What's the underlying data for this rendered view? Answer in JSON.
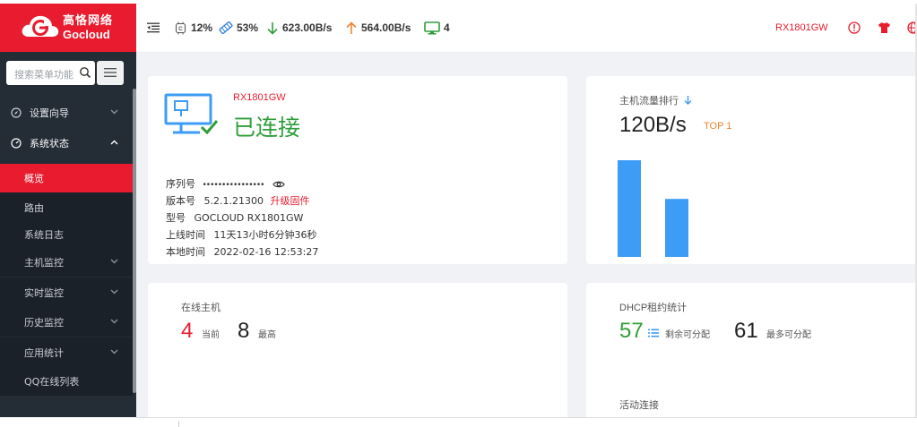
{
  "brand": {
    "name_cn": "高恪网络",
    "name_en": "Gocloud",
    "color": "#e81c2e"
  },
  "sidebar": {
    "search_placeholder": "搜索菜单功能",
    "items": [
      {
        "label": "设置向导",
        "icon": "compass-icon",
        "level": "top",
        "expanded": false
      },
      {
        "label": "系统状态",
        "icon": "dashboard-icon",
        "level": "top",
        "expanded": true
      },
      {
        "label": "概览",
        "level": "sub",
        "active": true
      },
      {
        "label": "路由",
        "level": "sub"
      },
      {
        "label": "系统日志",
        "level": "sub"
      },
      {
        "label": "主机监控",
        "level": "sub",
        "has_children": true
      },
      {
        "label": "实时监控",
        "level": "sub",
        "has_children": true
      },
      {
        "label": "历史监控",
        "level": "sub",
        "has_children": true
      },
      {
        "label": "应用统计",
        "level": "sub",
        "has_children": true
      },
      {
        "label": "QQ在线列表",
        "level": "sub"
      }
    ]
  },
  "header": {
    "cpu": "12%",
    "memory": "53%",
    "download": "623.00B/s",
    "upload": "564.00B/s",
    "clients": "4",
    "device": "RX1801GW",
    "colors": {
      "download": "#2e9e3a",
      "upload": "#f0832a",
      "monitor": "#2e9e3a",
      "accent": "#e81c2e"
    }
  },
  "device_card": {
    "model_short": "RX1801GW",
    "status": "已连接",
    "status_color": "#2e9e3a",
    "serial_label": "序列号",
    "serial_value": "••••••••••••••••",
    "version_label": "版本号",
    "version_value": "5.2.1.21300",
    "upgrade_link": "升级固件",
    "model_label": "型号",
    "model_value": "GOCLOUD RX1801GW",
    "uptime_label": "上线时间",
    "uptime_value": "11天13小时6分钟36秒",
    "localtime_label": "本地时间",
    "localtime_value": "2022-02-16 12:53:27"
  },
  "traffic_card": {
    "title": "主机流量排行",
    "value": "120B/s",
    "rank": "TOP 1",
    "chart_data": {
      "type": "bar",
      "series": [
        {
          "values": [
            100,
            60
          ]
        }
      ],
      "color": "#3d9cf5"
    }
  },
  "online_card": {
    "title": "在线主机",
    "current_value": "4",
    "current_label": "当前",
    "max_value": "8",
    "max_label": "最高"
  },
  "dhcp_card": {
    "title": "DHCP租约统计",
    "remaining_value": "57",
    "remaining_label": "剩余可分配",
    "max_value": "61",
    "max_label": "最多可分配",
    "active_title": "活动连接"
  }
}
